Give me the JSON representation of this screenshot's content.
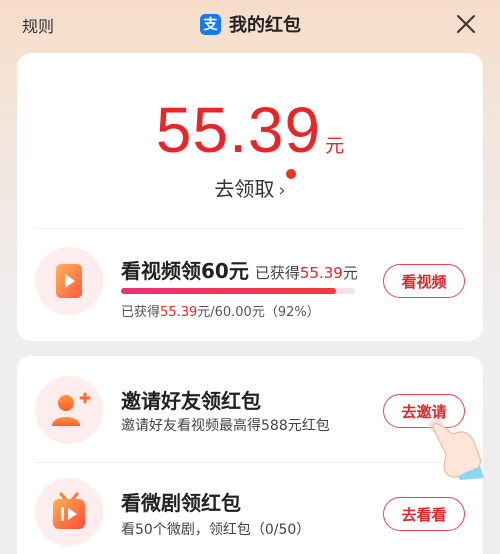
{
  "header": {
    "rules": "规则",
    "title": "我的红包",
    "logo_char": "支"
  },
  "balance": {
    "amount": "55.39",
    "unit": "元",
    "claim_label": "去领取",
    "claim_arrow": "›"
  },
  "tasks": [
    {
      "title": "看视频领60元",
      "earned_prefix": "已获得",
      "earned_amount": "55.39",
      "earned_unit": "元",
      "progress_prefix": "已获得",
      "progress_amount": "55.39",
      "progress_rest": "元/60.00元（92%）",
      "progress_ratio": 0.92,
      "button": "看视频"
    },
    {
      "title": "邀请好友领红包",
      "subtitle": "邀请好友看视频最高得588元红包",
      "button": "去邀请"
    },
    {
      "title": "看微剧领红包",
      "subtitle": "看50个微剧，领红包（0/50）",
      "button": "去看看"
    }
  ],
  "colors": {
    "accent": "#ea2427",
    "brand": "#1677ff"
  }
}
